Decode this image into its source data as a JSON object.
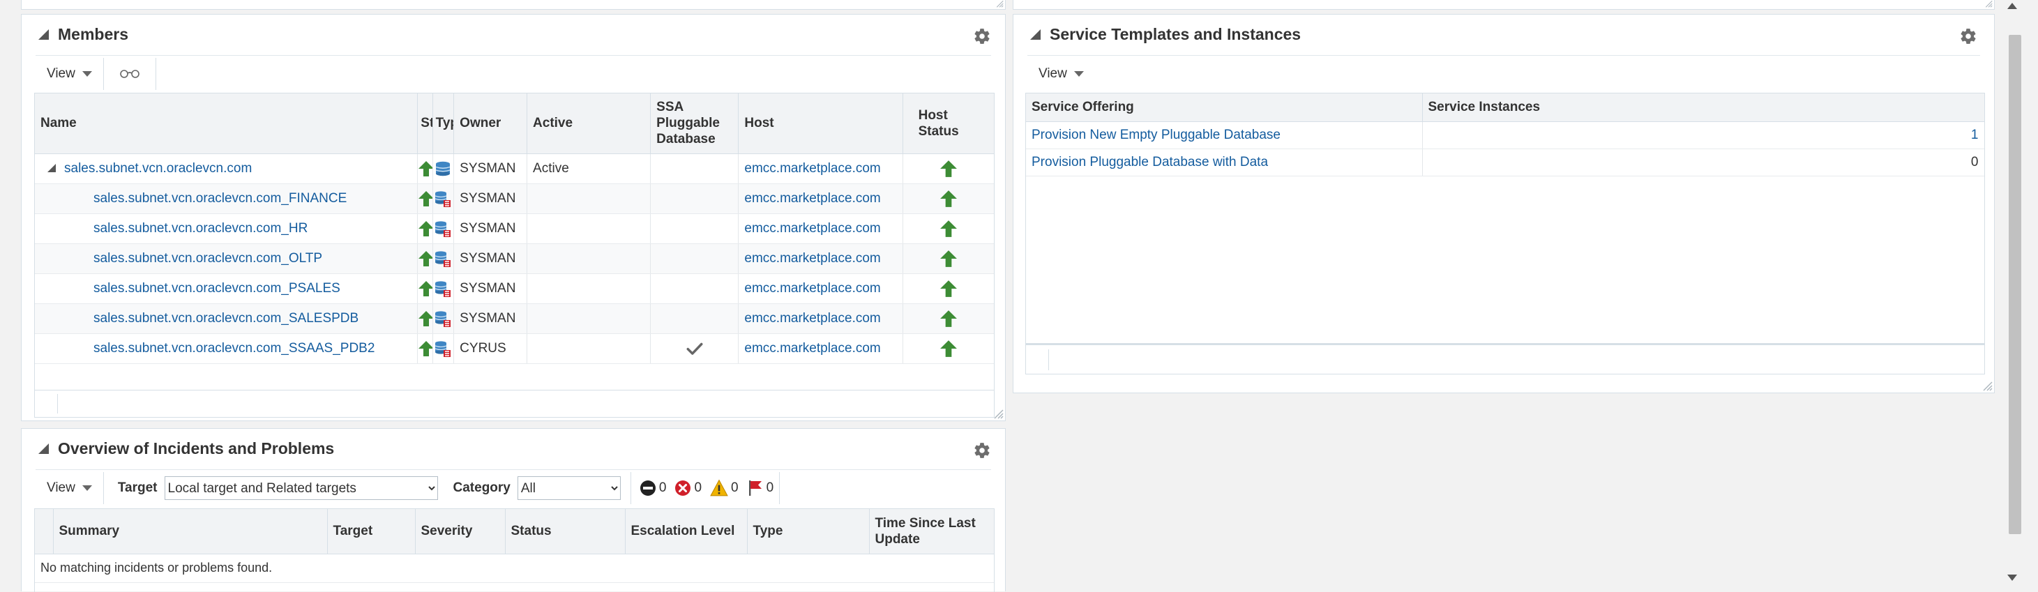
{
  "members": {
    "title": "Members",
    "view_label": "View",
    "columns": [
      "Name",
      "Status",
      "Type",
      "Owner",
      "Active",
      "SSA Pluggable Database",
      "Host",
      "Host Status"
    ],
    "column_labels_shown": {
      "status": "Sta",
      "type": "Typ"
    },
    "rows": [
      {
        "name": "sales.subnet.vcn.oraclevcn.com",
        "owner": "SYSMAN",
        "active": "Active",
        "ssa": false,
        "host": "emcc.marketplace.com",
        "parent": true
      },
      {
        "name": "sales.subnet.vcn.oraclevcn.com_FINANCE",
        "owner": "SYSMAN",
        "active": "",
        "ssa": false,
        "host": "emcc.marketplace.com",
        "parent": false
      },
      {
        "name": "sales.subnet.vcn.oraclevcn.com_HR",
        "owner": "SYSMAN",
        "active": "",
        "ssa": false,
        "host": "emcc.marketplace.com",
        "parent": false
      },
      {
        "name": "sales.subnet.vcn.oraclevcn.com_OLTP",
        "owner": "SYSMAN",
        "active": "",
        "ssa": false,
        "host": "emcc.marketplace.com",
        "parent": false
      },
      {
        "name": "sales.subnet.vcn.oraclevcn.com_PSALES",
        "owner": "SYSMAN",
        "active": "",
        "ssa": false,
        "host": "emcc.marketplace.com",
        "parent": false
      },
      {
        "name": "sales.subnet.vcn.oraclevcn.com_SALESPDB",
        "owner": "SYSMAN",
        "active": "",
        "ssa": false,
        "host": "emcc.marketplace.com",
        "parent": false
      },
      {
        "name": "sales.subnet.vcn.oraclevcn.com_SSAAS_PDB2",
        "owner": "CYRUS",
        "active": "",
        "ssa": true,
        "host": "emcc.marketplace.com",
        "parent": false
      }
    ]
  },
  "incidents": {
    "title": "Overview of Incidents and Problems",
    "view_label": "View",
    "target_label": "Target",
    "target_value": "Local target and Related targets",
    "category_label": "Category",
    "category_value": "All",
    "counts": {
      "critical": "0",
      "error": "0",
      "warning": "0",
      "flag": "0"
    },
    "columns": [
      "Summary",
      "Target",
      "Severity",
      "Status",
      "Escalation Level",
      "Type",
      "Time Since Last Update"
    ],
    "empty_message": "No matching incidents or problems found."
  },
  "service": {
    "title": "Service Templates and Instances",
    "view_label": "View",
    "columns": [
      "Service Offering",
      "Service Instances"
    ],
    "rows": [
      {
        "offering": "Provision New Empty Pluggable Database",
        "instances": "1",
        "instances_link": true
      },
      {
        "offering": "Provision Pluggable Database with Data",
        "instances": "0",
        "instances_link": false
      }
    ]
  },
  "colors": {
    "link": "#145c9e",
    "up_arrow": "#3d8c35",
    "error": "#d0202a",
    "warning": "#f0b400"
  }
}
